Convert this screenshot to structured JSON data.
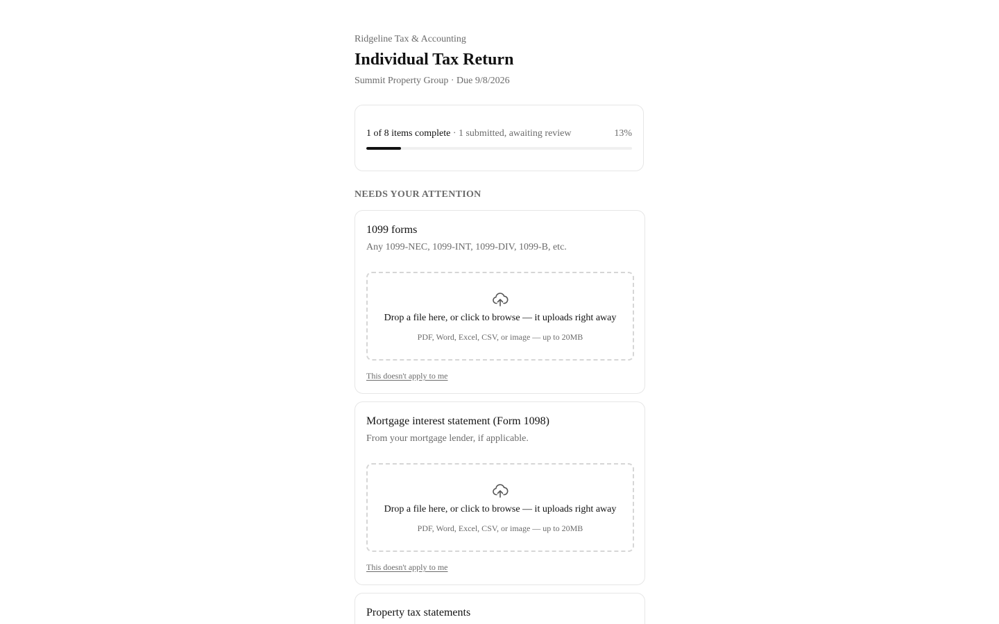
{
  "header": {
    "firm_name": "Ridgeline Tax & Accounting",
    "title": "Individual Tax Return",
    "client": "Summit Property Group",
    "due_sep": " · ",
    "due": "Due 9/8/2026"
  },
  "progress": {
    "complete_text": "1 of 8 items complete",
    "separator": " · ",
    "review_text": "1 submitted, awaiting review",
    "percent_label": "13%",
    "percent": 13,
    "fill_color": "#111111"
  },
  "section": {
    "heading": "NEEDS YOUR ATTENTION"
  },
  "items": [
    {
      "title": "1099 forms",
      "description": "Any 1099-NEC, 1099-INT, 1099-DIV, 1099-B, etc.",
      "drop_text": "Drop a file here, or click to browse — it uploads right away",
      "drop_hint": "PDF, Word, Excel, CSV, or image — up to 20MB",
      "not_applicable": "This doesn't apply to me",
      "icon": "cloud-upload-icon"
    },
    {
      "title": "Mortgage interest statement (Form 1098)",
      "description": "From your mortgage lender, if applicable.",
      "drop_text": "Drop a file here, or click to browse — it uploads right away",
      "drop_hint": "PDF, Word, Excel, CSV, or image — up to 20MB",
      "not_applicable": "This doesn't apply to me",
      "icon": "cloud-upload-icon"
    },
    {
      "title": "Property tax statements"
    }
  ]
}
